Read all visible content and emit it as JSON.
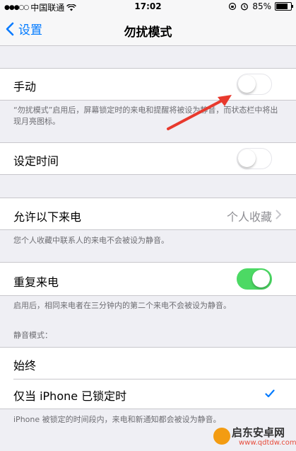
{
  "status_bar": {
    "carrier": "中国联通",
    "time": "17:02",
    "battery": "85%"
  },
  "nav": {
    "back_label": "设置",
    "title": "勿扰模式"
  },
  "manual": {
    "label": "手动",
    "enabled": false,
    "footnote": "“勿扰模式”启用后，屏幕锁定时的来电和提醒将被设为静音，而状态栏中将出现月亮图标。"
  },
  "scheduled": {
    "label": "设定时间",
    "enabled": false
  },
  "allow_calls": {
    "label": "允许以下来电",
    "value": "个人收藏",
    "footnote": "您个人收藏中联系人的来电不会被设为静音。"
  },
  "repeated_calls": {
    "label": "重复来电",
    "enabled": true,
    "footnote": "启用后，相同来电者在三分钟内的第二个来电不会被设为静音。"
  },
  "silence": {
    "header": "静音模式：",
    "options": [
      {
        "label": "始终",
        "selected": false
      },
      {
        "label": "仅当 iPhone 已锁定时",
        "selected": true
      }
    ],
    "footnote": "iPhone 被锁定的时间段内，来电和新通知都会被设为静音。"
  },
  "watermark": {
    "text": "启东安卓网",
    "url": "www.qdtdw.com"
  },
  "colors": {
    "accent": "#007aff",
    "toggle_on": "#4cd964",
    "annotation_arrow": "#e8392d"
  }
}
